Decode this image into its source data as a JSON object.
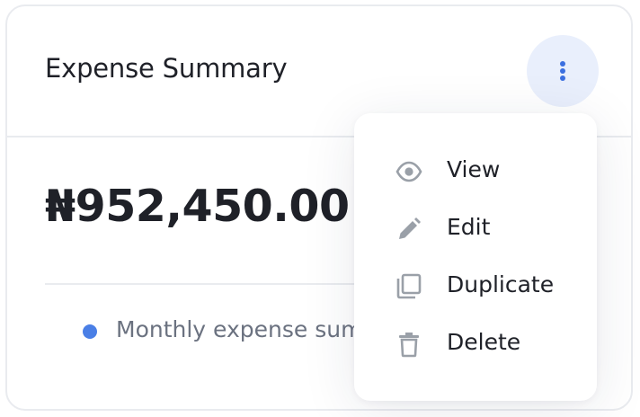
{
  "card": {
    "title": "Expense Summary",
    "amount": "₦952,450.00",
    "legend_text": "Monthly expense summary"
  },
  "menu": {
    "items": [
      {
        "label": "View",
        "icon": "eye-icon"
      },
      {
        "label": "Edit",
        "icon": "pencil-icon"
      },
      {
        "label": "Duplicate",
        "icon": "copy-icon"
      },
      {
        "label": "Delete",
        "icon": "trash-icon"
      }
    ]
  },
  "colors": {
    "accent": "#3b6fe0",
    "legend_dot": "#4a7fe6",
    "kebab_bg": "#e9effc",
    "text_primary": "#1f2128",
    "text_muted": "#6b7280",
    "icon_gray": "#9aa0a8"
  }
}
